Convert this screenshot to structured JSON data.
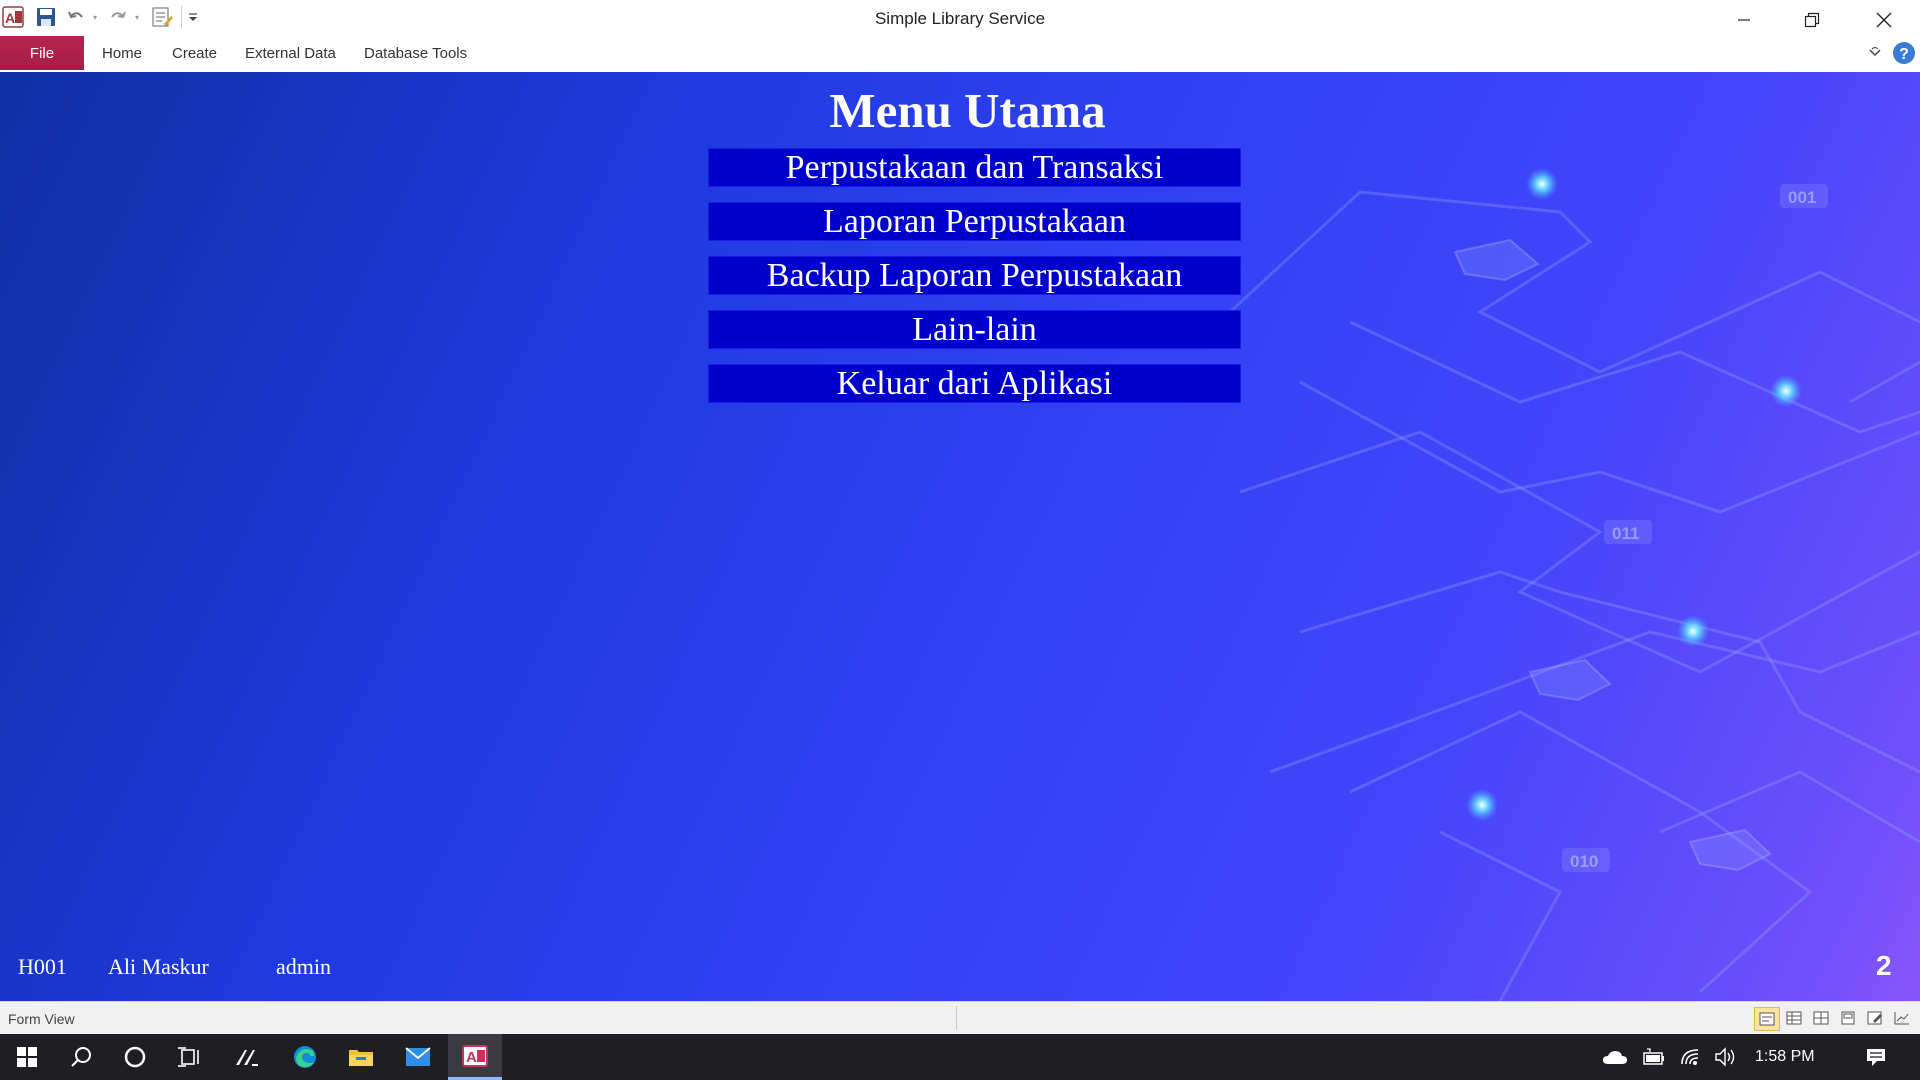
{
  "window": {
    "title": "Simple Library Service"
  },
  "quick_access": {
    "icons": [
      "access-app-icon",
      "save-icon",
      "undo-icon",
      "redo-icon",
      "form-edit-icon",
      "customize-qat-icon"
    ]
  },
  "ribbon": {
    "file_label": "File",
    "tabs": [
      "Home",
      "Create",
      "External Data",
      "Database Tools"
    ]
  },
  "form": {
    "title": "Menu Utama",
    "menu_buttons": [
      "Perpustakaan dan Transaksi",
      "Laporan Perpustakaan",
      "Backup Laporan Perpustakaan",
      "Lain-lain",
      "Keluar dari Aplikasi"
    ],
    "user_id": "H001",
    "user_name": "Ali Maskur",
    "user_role": "admin",
    "page_number": "2",
    "background_labels": [
      "001",
      "011",
      "010"
    ]
  },
  "statusbar": {
    "view_label": "Form View"
  },
  "taskbar": {
    "clock": "1:58 PM",
    "apps": [
      "windows-start-icon",
      "search-icon",
      "cortana-icon",
      "task-view-icon",
      "pen-app-icon",
      "edge-icon",
      "file-explorer-icon",
      "mail-icon",
      "access-taskbar-icon"
    ],
    "tray": [
      "onedrive-icon",
      "battery-icon",
      "wifi-icon",
      "volume-icon",
      "notifications-icon"
    ]
  },
  "colors": {
    "file_tab": "#a31e47",
    "menu_button": "#0000cc",
    "background_start": "#0f2fa3",
    "background_end": "#8b55fb",
    "taskbar": "#1f1f23"
  }
}
